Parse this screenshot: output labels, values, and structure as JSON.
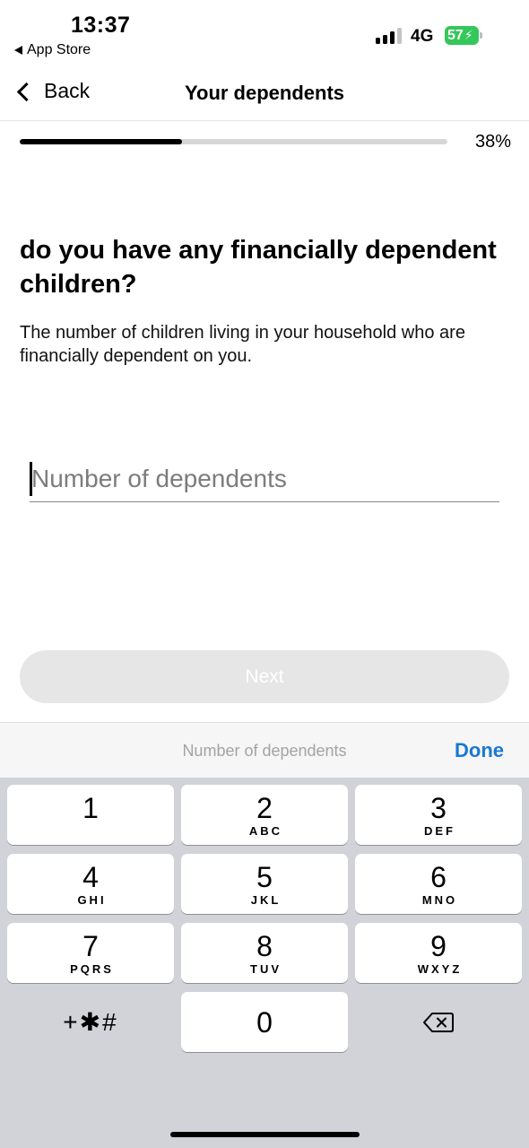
{
  "status_bar": {
    "time": "13:37",
    "back_app": "App Store",
    "network": "4G",
    "battery": "57"
  },
  "nav": {
    "back_label": "Back",
    "title": "Your dependents"
  },
  "progress": {
    "value": 0.38,
    "label": "38%"
  },
  "question": {
    "title": "do you have any financially dependent children?",
    "description": "The number of children living in your household who are financially dependent on you."
  },
  "dependents_input": {
    "placeholder": "Number of dependents",
    "value": ""
  },
  "next_button": {
    "label": "Next",
    "enabled": false
  },
  "keyboard": {
    "accessory_hint": "Number of dependents",
    "done_label": "Done",
    "keys": [
      {
        "num": "1",
        "letters": ""
      },
      {
        "num": "2",
        "letters": "ABC"
      },
      {
        "num": "3",
        "letters": "DEF"
      },
      {
        "num": "4",
        "letters": "GHI"
      },
      {
        "num": "5",
        "letters": "JKL"
      },
      {
        "num": "6",
        "letters": "MNO"
      },
      {
        "num": "7",
        "letters": "PQRS"
      },
      {
        "num": "8",
        "letters": "TUV"
      },
      {
        "num": "9",
        "letters": "WXYZ"
      }
    ],
    "symbols_label": "+✱#",
    "zero": "0",
    "delete_icon": "delete-backspace-icon"
  }
}
